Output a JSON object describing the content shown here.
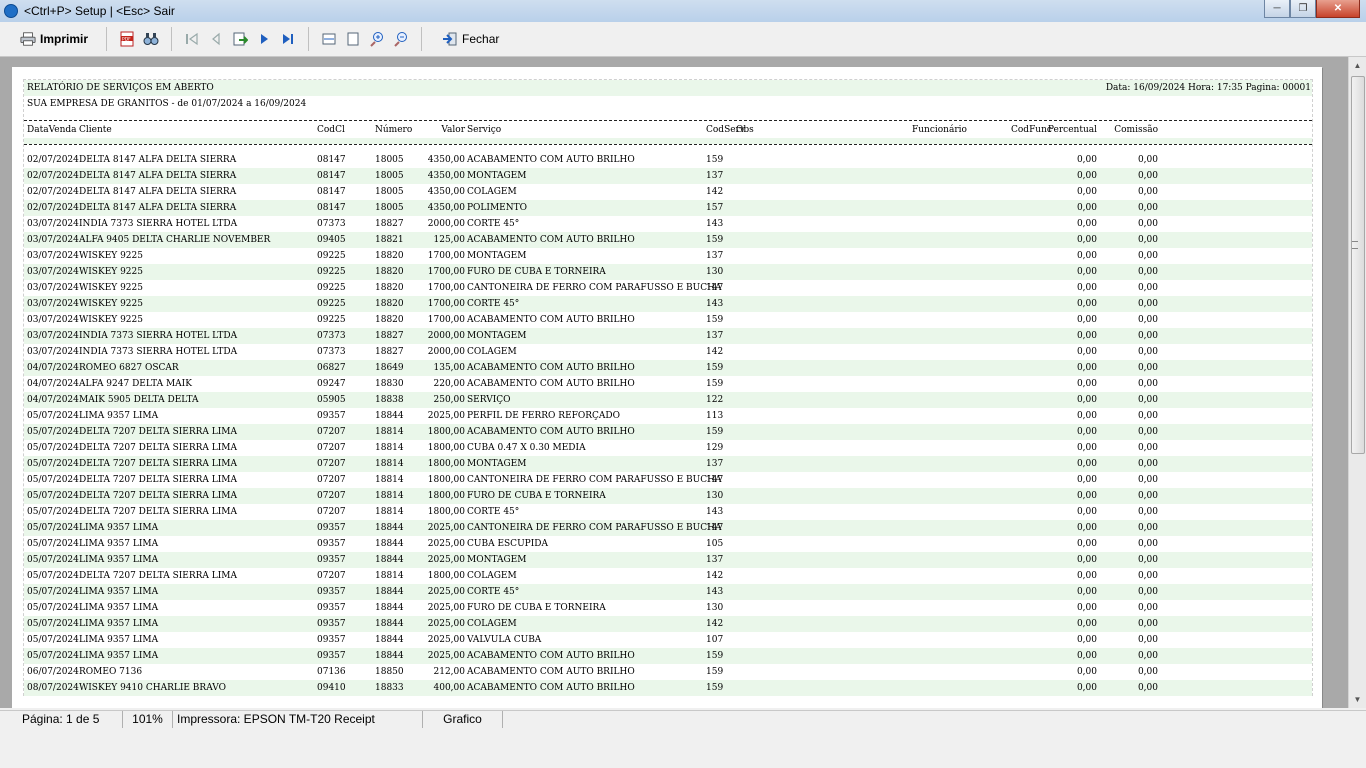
{
  "window": {
    "title": "<Ctrl+P> Setup | <Esc> Sair",
    "buttons": [
      "minimize",
      "maximize",
      "close"
    ]
  },
  "toolbar": {
    "print_label": "Imprimir",
    "close_label": "Fechar",
    "icons": [
      "printer-icon",
      "pdf-icon",
      "find-icon",
      "first-page-icon",
      "prev-page-icon",
      "goto-page-icon",
      "next-page-icon",
      "last-page-icon",
      "page-width-icon",
      "whole-page-icon",
      "zoom-in-icon",
      "zoom-out-icon",
      "exit-icon"
    ]
  },
  "report": {
    "title": "RELATÓRIO DE SERVIÇOS EM ABERTO",
    "header_right": "Data: 16/09/2024 Hora: 17:35 Pagina: 00001",
    "subtitle": "SUA EMPRESA DE GRANITOS - de 01/07/2024 a 16/09/2024",
    "columns": {
      "date": "DataVenda",
      "client": "Cliente",
      "codcl": "CodCl",
      "number": "Número",
      "value": "Valor",
      "service": "Serviço",
      "codserv": "CodServ",
      "obs": "Obs",
      "employee": "Funcionário",
      "codfunc": "CodFunc",
      "percent": "Percentual",
      "commission": "Comissão"
    },
    "rows": [
      [
        "02/07/2024",
        "DELTA 8147 ALFA DELTA SIERRA",
        "08147",
        "18005",
        "4350,00",
        "ACABAMENTO COM AUTO BRILHO",
        "159",
        "0,00",
        "0,00"
      ],
      [
        "02/07/2024",
        "DELTA 8147 ALFA DELTA SIERRA",
        "08147",
        "18005",
        "4350,00",
        "MONTAGEM",
        "137",
        "0,00",
        "0,00"
      ],
      [
        "02/07/2024",
        "DELTA 8147 ALFA DELTA SIERRA",
        "08147",
        "18005",
        "4350,00",
        "COLAGEM",
        "142",
        "0,00",
        "0,00"
      ],
      [
        "02/07/2024",
        "DELTA 8147 ALFA DELTA SIERRA",
        "08147",
        "18005",
        "4350,00",
        "POLIMENTO",
        "157",
        "0,00",
        "0,00"
      ],
      [
        "03/07/2024",
        "INDIA 7373 SIERRA HOTEL LTDA",
        "07373",
        "18827",
        "2000,00",
        "CORTE 45°",
        "143",
        "0,00",
        "0,00"
      ],
      [
        "03/07/2024",
        "ALFA 9405 DELTA CHARLIE NOVEMBER",
        "09405",
        "18821",
        "125,00",
        "ACABAMENTO COM AUTO BRILHO",
        "159",
        "0,00",
        "0,00"
      ],
      [
        "03/07/2024",
        "WISKEY 9225",
        "09225",
        "18820",
        "1700,00",
        "MONTAGEM",
        "137",
        "0,00",
        "0,00"
      ],
      [
        "03/07/2024",
        "WISKEY 9225",
        "09225",
        "18820",
        "1700,00",
        "FURO DE CUBA E TORNEIRA",
        "130",
        "0,00",
        "0,00"
      ],
      [
        "03/07/2024",
        "WISKEY 9225",
        "09225",
        "18820",
        "1700,00",
        "CANTONEIRA DE FERRO COM PARAFUSSO E BUCHA",
        "147",
        "0,00",
        "0,00"
      ],
      [
        "03/07/2024",
        "WISKEY 9225",
        "09225",
        "18820",
        "1700,00",
        "CORTE 45°",
        "143",
        "0,00",
        "0,00"
      ],
      [
        "03/07/2024",
        "WISKEY 9225",
        "09225",
        "18820",
        "1700,00",
        "ACABAMENTO COM AUTO BRILHO",
        "159",
        "0,00",
        "0,00"
      ],
      [
        "03/07/2024",
        "INDIA 7373 SIERRA HOTEL LTDA",
        "07373",
        "18827",
        "2000,00",
        "MONTAGEM",
        "137",
        "0,00",
        "0,00"
      ],
      [
        "03/07/2024",
        "INDIA 7373 SIERRA HOTEL LTDA",
        "07373",
        "18827",
        "2000,00",
        "COLAGEM",
        "142",
        "0,00",
        "0,00"
      ],
      [
        "04/07/2024",
        "ROMEO 6827 OSCAR",
        "06827",
        "18649",
        "135,00",
        "ACABAMENTO COM AUTO BRILHO",
        "159",
        "0,00",
        "0,00"
      ],
      [
        "04/07/2024",
        "ALFA 9247 DELTA MAIK",
        "09247",
        "18830",
        "220,00",
        "ACABAMENTO COM AUTO BRILHO",
        "159",
        "0,00",
        "0,00"
      ],
      [
        "04/07/2024",
        "MAIK 5905 DELTA DELTA",
        "05905",
        "18838",
        "250,00",
        "SERVIÇO",
        "122",
        "0,00",
        "0,00"
      ],
      [
        "05/07/2024",
        "LIMA 9357 LIMA",
        "09357",
        "18844",
        "2025,00",
        "PERFIL DE FERRO REFORÇADO",
        "113",
        "0,00",
        "0,00"
      ],
      [
        "05/07/2024",
        "DELTA 7207 DELTA SIERRA LIMA",
        "07207",
        "18814",
        "1800,00",
        "ACABAMENTO COM AUTO BRILHO",
        "159",
        "0,00",
        "0,00"
      ],
      [
        "05/07/2024",
        "DELTA 7207 DELTA SIERRA LIMA",
        "07207",
        "18814",
        "1800,00",
        "CUBA 0.47 X 0.30 MEDIA",
        "129",
        "0,00",
        "0,00"
      ],
      [
        "05/07/2024",
        "DELTA 7207 DELTA SIERRA LIMA",
        "07207",
        "18814",
        "1800,00",
        "MONTAGEM",
        "137",
        "0,00",
        "0,00"
      ],
      [
        "05/07/2024",
        "DELTA 7207 DELTA SIERRA LIMA",
        "07207",
        "18814",
        "1800,00",
        "CANTONEIRA DE FERRO COM PARAFUSSO E BUCHA",
        "147",
        "0,00",
        "0,00"
      ],
      [
        "05/07/2024",
        "DELTA 7207 DELTA SIERRA LIMA",
        "07207",
        "18814",
        "1800,00",
        "FURO DE CUBA E TORNEIRA",
        "130",
        "0,00",
        "0,00"
      ],
      [
        "05/07/2024",
        "DELTA 7207 DELTA SIERRA LIMA",
        "07207",
        "18814",
        "1800,00",
        "CORTE 45°",
        "143",
        "0,00",
        "0,00"
      ],
      [
        "05/07/2024",
        "LIMA 9357 LIMA",
        "09357",
        "18844",
        "2025,00",
        "CANTONEIRA DE FERRO COM PARAFUSSO E BUCHA",
        "147",
        "0,00",
        "0,00"
      ],
      [
        "05/07/2024",
        "LIMA 9357 LIMA",
        "09357",
        "18844",
        "2025,00",
        "CUBA ESCUPIDA",
        "105",
        "0,00",
        "0,00"
      ],
      [
        "05/07/2024",
        "LIMA 9357 LIMA",
        "09357",
        "18844",
        "2025,00",
        "MONTAGEM",
        "137",
        "0,00",
        "0,00"
      ],
      [
        "05/07/2024",
        "DELTA 7207 DELTA SIERRA LIMA",
        "07207",
        "18814",
        "1800,00",
        "COLAGEM",
        "142",
        "0,00",
        "0,00"
      ],
      [
        "05/07/2024",
        "LIMA 9357 LIMA",
        "09357",
        "18844",
        "2025,00",
        "CORTE 45°",
        "143",
        "0,00",
        "0,00"
      ],
      [
        "05/07/2024",
        "LIMA 9357 LIMA",
        "09357",
        "18844",
        "2025,00",
        "FURO DE CUBA E TORNEIRA",
        "130",
        "0,00",
        "0,00"
      ],
      [
        "05/07/2024",
        "LIMA 9357 LIMA",
        "09357",
        "18844",
        "2025,00",
        "COLAGEM",
        "142",
        "0,00",
        "0,00"
      ],
      [
        "05/07/2024",
        "LIMA 9357 LIMA",
        "09357",
        "18844",
        "2025,00",
        "VALVULA CUBA",
        "107",
        "0,00",
        "0,00"
      ],
      [
        "05/07/2024",
        "LIMA 9357 LIMA",
        "09357",
        "18844",
        "2025,00",
        "ACABAMENTO COM AUTO BRILHO",
        "159",
        "0,00",
        "0,00"
      ],
      [
        "06/07/2024",
        "ROMEO 7136",
        "07136",
        "18850",
        "212,00",
        "ACABAMENTO COM AUTO BRILHO",
        "159",
        "0,00",
        "0,00"
      ],
      [
        "08/07/2024",
        "WISKEY 9410 CHARLIE BRAVO",
        "09410",
        "18833",
        "400,00",
        "ACABAMENTO COM AUTO BRILHO",
        "159",
        "0,00",
        "0,00"
      ]
    ]
  },
  "statusbar": {
    "page": "Página: 1 de 5",
    "zoom": "101%",
    "printer": "Impressora: EPSON TM-T20 Receipt",
    "mode": "Grafico"
  }
}
